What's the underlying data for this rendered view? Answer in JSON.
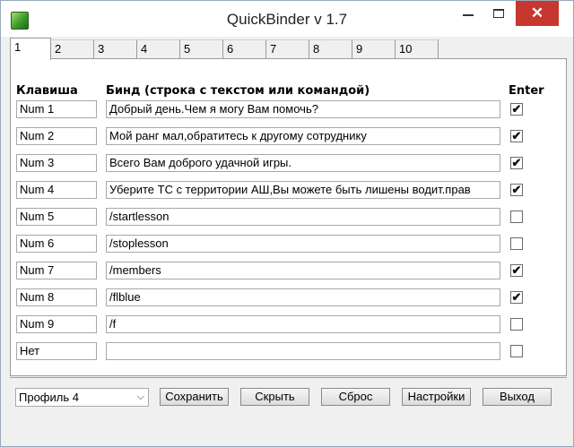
{
  "window": {
    "title": "QuickBinder v 1.7",
    "close_glyph": "✕"
  },
  "tabs": [
    "1",
    "2",
    "3",
    "4",
    "5",
    "6",
    "7",
    "8",
    "9",
    "10"
  ],
  "active_tab": "1",
  "headers": {
    "key": "Клавиша",
    "bind": "Бинд (строка с текстом или командой)",
    "enter": "Enter"
  },
  "rows": [
    {
      "key": "Num 1",
      "bind": "Добрый день.Чем я могу Вам помочь?",
      "enter": true
    },
    {
      "key": "Num 2",
      "bind": "Мой ранг мал,обратитесь к другому сотруднику",
      "enter": true
    },
    {
      "key": "Num 3",
      "bind": "Всего Вам доброго удачной игры.",
      "enter": true
    },
    {
      "key": "Num 4",
      "bind": "Уберите ТС с территории АШ,Вы можете быть лишены водит.прав",
      "enter": true
    },
    {
      "key": "Num 5",
      "bind": "/startlesson",
      "enter": false
    },
    {
      "key": "Num 6",
      "bind": "/stoplesson",
      "enter": false
    },
    {
      "key": "Num 7",
      "bind": "/members",
      "enter": true
    },
    {
      "key": "Num 8",
      "bind": "/flblue",
      "enter": true
    },
    {
      "key": "Num 9",
      "bind": "/f",
      "enter": false
    },
    {
      "key": "Нет",
      "bind": "",
      "enter": false
    }
  ],
  "footer": {
    "profile": "Профиль 4",
    "save": "Сохранить",
    "hide": "Скрыть",
    "reset": "Сброс",
    "settings": "Настройки",
    "exit": "Выход"
  },
  "colors": {
    "close_button": "#c7372f",
    "app_icon": "#3c9a2a"
  }
}
